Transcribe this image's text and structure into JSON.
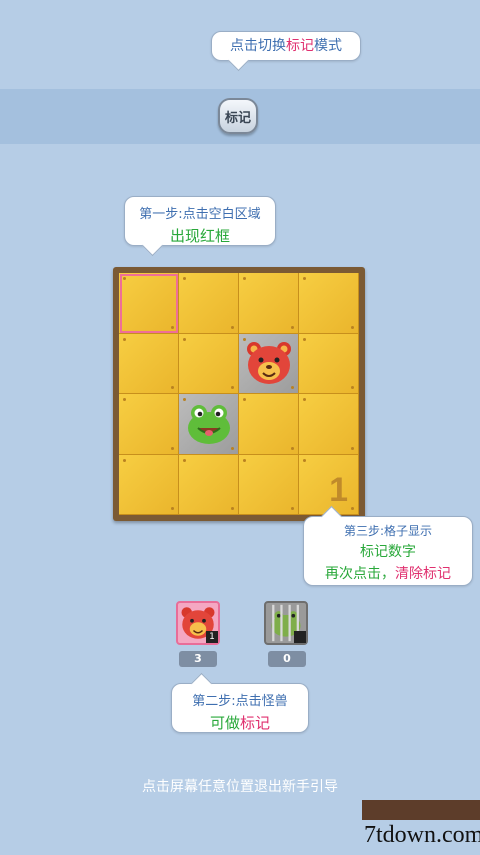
{
  "tip_mark_mode": {
    "part1": "点击切换",
    "part2": "标记",
    "part3": "模式"
  },
  "mark_button_label": "标记",
  "step1": {
    "line1": "第一步:点击空白区域",
    "line2": "出现红框"
  },
  "step2": {
    "line1": "第二步:点击怪兽",
    "line2a": "可做",
    "line2b": "标记"
  },
  "step3": {
    "line1": "第三步:格子显示",
    "line2": "标记数字",
    "line3a": "再次点击，",
    "line3b": "清除标记"
  },
  "board": {
    "marked_cell_number": "1"
  },
  "monsters": [
    {
      "name": "red-bear",
      "badge": "1",
      "count": "3"
    },
    {
      "name": "green-frog-caged",
      "badge": "",
      "count": "0"
    }
  ],
  "exit_hint": "点击屏幕任意位置退出新手引导",
  "watermark": "7tdown.com",
  "colors": {
    "background": "#b6cde6",
    "board_frame": "#7b5a34",
    "tile": "#f3c43a",
    "select_outline": "#ef6e97"
  }
}
